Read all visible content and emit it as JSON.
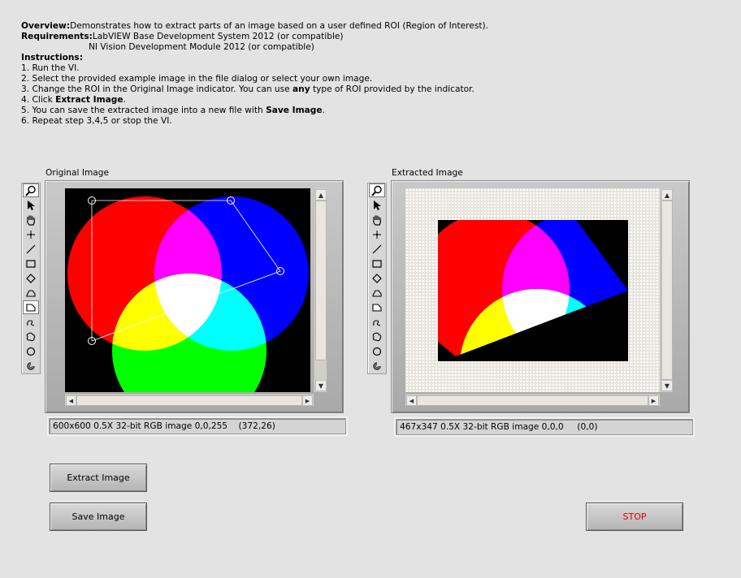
{
  "overview": {
    "overview_label": "Overview:",
    "overview_text": "Demonstrates how to extract parts of an image based on a user defined ROI (Region of Interest).",
    "requirements_label": "Requirements:",
    "requirements_line1": "LabVIEW Base Development System 2012 (or compatible)",
    "requirements_line2": "NI Vision Development Module 2012 (or compatible)",
    "instructions_label": "Instructions:",
    "step1": "1. Run the VI.",
    "step2": "2. Select the provided example image in the file dialog or select your own image.",
    "step3_a": "3. Change the ROI in the Original Image indicator. You can use ",
    "step3_b": "any",
    "step3_c": " type of ROI provided by the indicator.",
    "step4_a": "4. Click ",
    "step4_b": "Extract Image",
    "step4_c": ".",
    "step5_a": "5. You can save the extracted image into a new file with ",
    "step5_b": "Save Image",
    "step5_c": ".",
    "step6": "6. Repeat step 3,4,5 or stop the VI."
  },
  "original_image": {
    "label": "Original Image",
    "status": "600x600 0.5X 32-bit RGB image 0,0,255    (372,26)"
  },
  "extracted_image": {
    "label": "Extracted Image",
    "status": "467x347 0.5X 32-bit RGB image 0,0,0     (0,0)"
  },
  "tools": [
    "zoom-icon",
    "pointer-icon",
    "pan-hand-icon",
    "point-tool-icon",
    "line-tool-icon",
    "rectangle-tool-icon",
    "rotated-rectangle-tool-icon",
    "polygon-tool-icon",
    "freehand-line-tool-icon",
    "freehand-region-tool-icon",
    "closed-freehand-tool-icon",
    "oval-tool-icon",
    "annulus-tool-icon"
  ],
  "buttons": {
    "extract": "Extract Image",
    "save": "Save Image",
    "stop": "STOP"
  },
  "colors": {
    "stop_text": "#e00000",
    "background": "#e3e3e3"
  }
}
